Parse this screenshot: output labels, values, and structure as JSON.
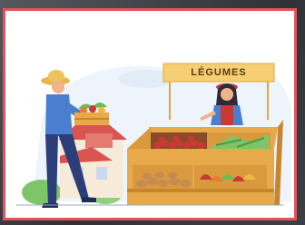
{
  "illustration": {
    "sign_text": "LÉGUMES",
    "palette": {
      "frame": "#e4525c",
      "crate": "#e8a94a",
      "crate_dark": "#c9852c",
      "farmer_shirt": "#4a7fd0",
      "farmer_pants": "#2c3e78",
      "house_roof": "#d9534f",
      "leaves": "#6dbb55",
      "tomatoes": "#c93a35",
      "potatoes": "#c68a52"
    },
    "icons": [
      "farmer-figure",
      "vendor-figure",
      "market-stall",
      "house",
      "vegetable-crate"
    ]
  }
}
